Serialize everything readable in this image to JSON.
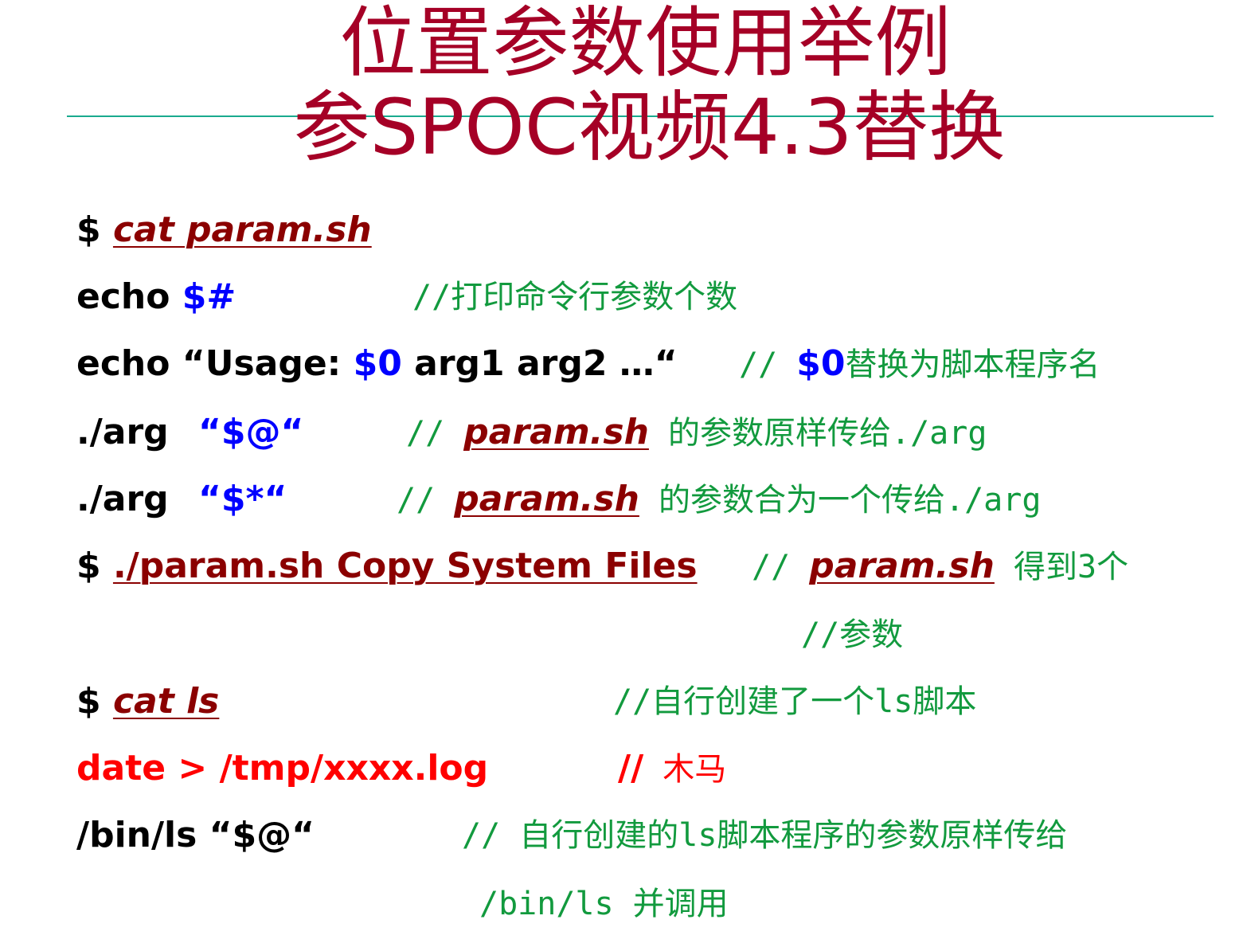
{
  "title": {
    "line1": "位置参数使用举例",
    "line2": "参SPOC视频4.3替换"
  },
  "lines": {
    "l1": {
      "prompt": "$ ",
      "cmd": "cat param.sh"
    },
    "l2": {
      "code": "echo ",
      "var": "$#",
      "comment": "//打印命令行参数个数"
    },
    "l3": {
      "code_a": "echo “Usage: ",
      "var": "$0",
      "code_b": " arg1 arg2 …“",
      "comment_a": "// ",
      "comment_var": "$0",
      "comment_b": "替换为脚本程序名"
    },
    "l4": {
      "code": "./arg ",
      "var": "“$@“",
      "comment_a": "// ",
      "comment_file": "param.sh",
      "comment_b": " 的参数原样传给./arg"
    },
    "l5": {
      "code": "./arg ",
      "var": "“$*“",
      "comment_a": "// ",
      "comment_file": "param.sh",
      "comment_b": " 的参数合为一个传给./arg"
    },
    "l6": {
      "prompt": "$ ",
      "cmd": "./param.sh Copy System Files",
      "comment_a": " // ",
      "comment_file": "param.sh",
      "comment_b": " 得到3个"
    },
    "l7": {
      "comment": "//参数"
    },
    "l8": {
      "prompt": "$ ",
      "cmd": "cat ls",
      "comment": "//自行创建了一个ls脚本"
    },
    "l9": {
      "code": "date > /tmp/xxxx.log",
      "comment_a": "//",
      "comment_b": " 木马"
    },
    "l10": {
      "code": "/bin/ls “$@“",
      "comment": "// 自行创建的ls脚本程序的参数原样传给"
    },
    "l11": {
      "comment": "/bin/ls 并调用"
    }
  },
  "colors": {
    "title": "#a50026",
    "rule": "#1aaa8e",
    "comment": "#129a3e",
    "variable": "#0000ff",
    "filename": "#8b0000",
    "trojan": "#ff0000"
  }
}
